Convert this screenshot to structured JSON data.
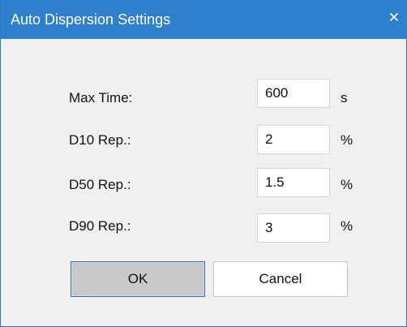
{
  "window": {
    "title": "Auto Dispersion Settings",
    "close_glyph": "×",
    "title_bar_color": "#2f7fcf",
    "background_color": "#f0f0f0"
  },
  "fields": [
    {
      "label": "Max Time:",
      "value": "600",
      "unit": "s"
    },
    {
      "label": "D10 Rep.:",
      "value": "2",
      "unit": "%"
    },
    {
      "label": "D50 Rep.:",
      "value": "1.5",
      "unit": "%"
    },
    {
      "label": "D90 Rep.:",
      "value": "3",
      "unit": "%"
    }
  ],
  "buttons": {
    "ok_label": "OK",
    "cancel_label": "Cancel"
  },
  "icons": {
    "close": "close-icon"
  }
}
